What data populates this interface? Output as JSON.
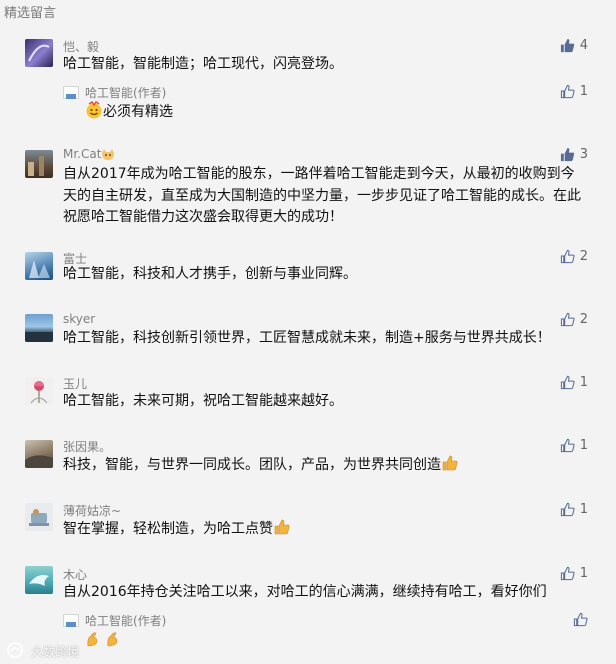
{
  "section_title": "精选留言",
  "comments": [
    {
      "nickname": "恺、毅",
      "content": "哈工智能，智能制造；哈工现代，闪亮登场。",
      "likes": "4",
      "liked": true,
      "reply": {
        "author": "哈工智能(作者)",
        "content": "必须有精选",
        "likes": "1"
      }
    },
    {
      "nickname": "Mr.Cat",
      "content": "自从2017年成为哈工智能的股东，一路伴着哈工智能走到今天，从最初的收购到今天的自主研发，直至成为大国制造的中坚力量，一步步见证了哈工智能的成长。在此祝愿哈工智能借力这次盛会取得更大的成功！",
      "likes": "3",
      "liked": true
    },
    {
      "nickname": "富士",
      "content": "哈工智能，科技和人才携手，创新与事业同辉。",
      "likes": "2",
      "liked": false
    },
    {
      "nickname": "skyer",
      "content": "哈工智能，科技创新引领世界，工匠智慧成就未来，制造+服务与世界共成长！",
      "likes": "2",
      "liked": false
    },
    {
      "nickname": "玉儿",
      "content": "哈工智能，未来可期，祝哈工智能越来越好。",
      "likes": "1",
      "liked": false
    },
    {
      "nickname": "张因果。",
      "content": "科技，智能，与世界一同成长。团队，产品，为世界共同创造",
      "likes": "1",
      "liked": false
    },
    {
      "nickname": "薄荷姑凉~",
      "content": "智在掌握，轻松制造，为哈工点赞",
      "likes": "1",
      "liked": false
    },
    {
      "nickname": "木心",
      "content": "自从2016年持仓关注哈工以来，对哈工的信心满满，继续持有哈工，看好你们",
      "likes": "1",
      "liked": false,
      "reply": {
        "author": "哈工智能(作者)",
        "content": "",
        "likes": ""
      }
    }
  ],
  "watermark": "大数跨境",
  "colors": {
    "background": "#f3f3f3",
    "liked_thumb": "#576b95",
    "unliked_thumb": "#576b95",
    "meta_text": "#7f7f7f"
  },
  "icons": [
    "thumbs-up-icon",
    "thumbs-up-outline-icon",
    "smile-emoji-icon",
    "thumbs-up-emoji-icon",
    "flex-arm-emoji-icon"
  ]
}
